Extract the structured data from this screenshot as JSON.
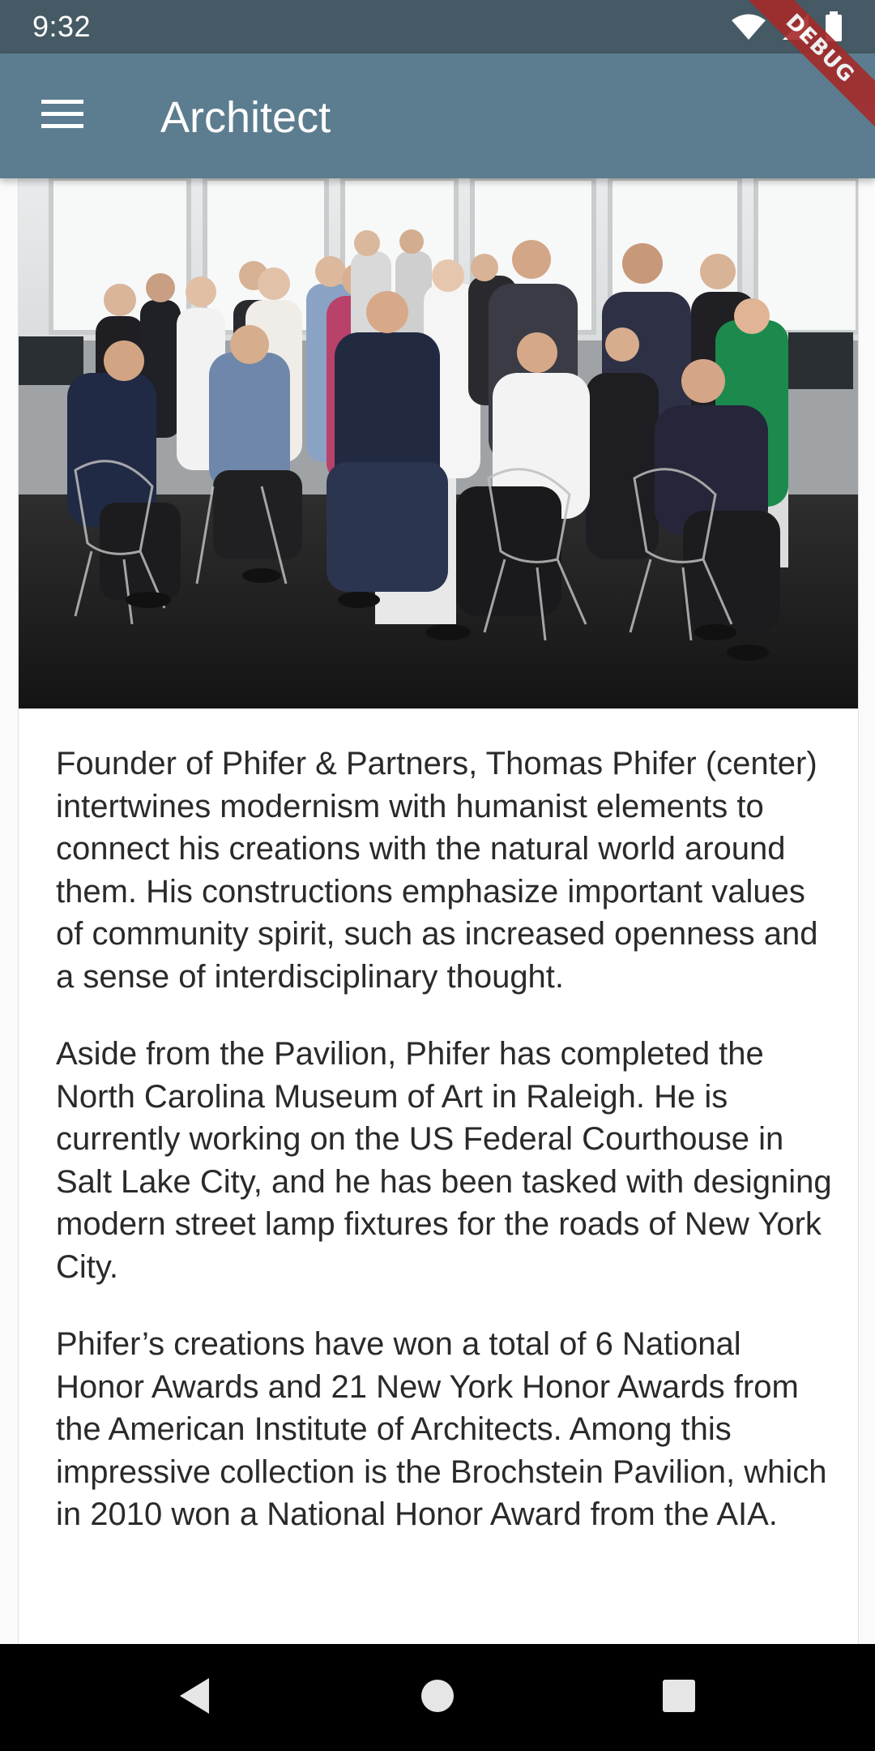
{
  "status_bar": {
    "time": "9:32",
    "icons": [
      "wifi-icon",
      "signal-icon",
      "battery-icon"
    ]
  },
  "app_bar": {
    "menu_icon": "hamburger-menu-icon",
    "title": "Architect",
    "color": "#5c7d8f"
  },
  "debug_banner": {
    "label": "DEBUG"
  },
  "hero_image": {
    "description_icon": "team-photo"
  },
  "article": {
    "paragraphs": [
      "Founder of Phifer & Partners, Thomas Phifer (center) intertwines modernism with humanist elements to connect his creations with the natural world around them. His constructions emphasize important values of community spirit, such as increased openness and a sense of interdisciplinary thought.",
      "Aside from the Pavilion, Phifer has completed the North Carolina Museum of Art in Raleigh. He is currently working on the US Federal Courthouse in Salt Lake City, and he has been tasked with designing modern street lamp fixtures for the roads of New York City.",
      "Phifer’s creations have won a total of 6 National Honor Awards and 21 New York Honor Awards from the American Institute of Architects. Among this impressive collection is the Brochstein Pavilion, which in 2010 won a National Honor Award from the AIA."
    ]
  },
  "navigation_bar": {
    "back": "back-triangle-icon",
    "home": "home-circle-icon",
    "recents": "recents-square-icon"
  }
}
